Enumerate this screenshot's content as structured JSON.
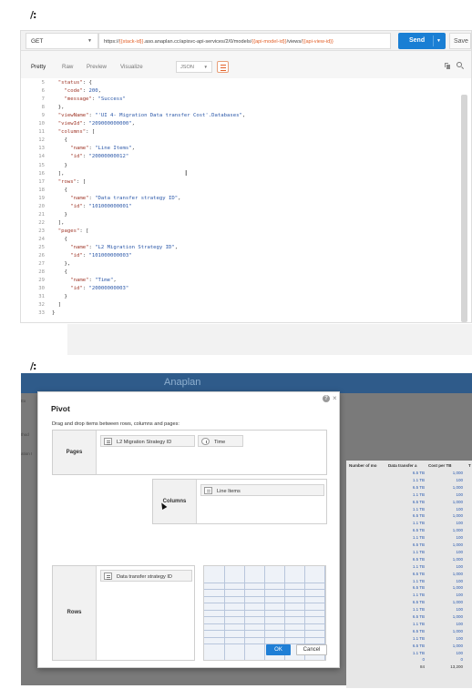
{
  "top": {
    "method": "GET",
    "url_parts": [
      {
        "t": "https://",
        "var": false
      },
      {
        "t": "{{stack-id}}",
        "var": true
      },
      {
        "t": ".aso.anaplan.cc/apisvc-api-services/2/0/models/",
        "var": false
      },
      {
        "t": "{{api-model-id}}",
        "var": true
      },
      {
        "t": "/views/",
        "var": false
      },
      {
        "t": "{{api-view-id}}",
        "var": true
      }
    ],
    "send_label": "Send",
    "save_label": "Save",
    "response_tabs": [
      "Pretty",
      "Raw",
      "Preview",
      "Visualize"
    ],
    "format": "JSON",
    "code_lines": [
      {
        "n": "5",
        "text": "  \"status\": {"
      },
      {
        "n": "6",
        "text": "    \"code\": 200,"
      },
      {
        "n": "7",
        "text": "    \"message\": \"Success\""
      },
      {
        "n": "8",
        "text": "  },"
      },
      {
        "n": "9",
        "text": "  \"viewName\": \"'UI 4- Migration Data transfer Cost'.Databases\","
      },
      {
        "n": "10",
        "text": "  \"viewId\": \"209000000000\","
      },
      {
        "n": "11",
        "text": "  \"columns\": ["
      },
      {
        "n": "12",
        "text": "    {"
      },
      {
        "n": "13",
        "text": "      \"name\": \"Line Items\","
      },
      {
        "n": "14",
        "text": "      \"id\": \"20000000012\""
      },
      {
        "n": "15",
        "text": "    }"
      },
      {
        "n": "16",
        "text": "  ],"
      },
      {
        "n": "17",
        "text": "  \"rows\": ["
      },
      {
        "n": "18",
        "text": "    {"
      },
      {
        "n": "19",
        "text": "      \"name\": \"Data transfer strategy ID\","
      },
      {
        "n": "20",
        "text": "      \"id\": \"101000000001\""
      },
      {
        "n": "21",
        "text": "    }"
      },
      {
        "n": "22",
        "text": "  ],"
      },
      {
        "n": "23",
        "text": "  \"pages\": ["
      },
      {
        "n": "24",
        "text": "    {"
      },
      {
        "n": "25",
        "text": "      \"name\": \"L2 Migration Strategy ID\","
      },
      {
        "n": "26",
        "text": "      \"id\": \"101000000003\""
      },
      {
        "n": "27",
        "text": "    },"
      },
      {
        "n": "28",
        "text": "    {"
      },
      {
        "n": "29",
        "text": "      \"name\": \"Time\","
      },
      {
        "n": "30",
        "text": "      \"id\": \"20000000003\""
      },
      {
        "n": "31",
        "text": "    }"
      },
      {
        "n": "32",
        "text": "  ]"
      },
      {
        "n": "33",
        "text": "}"
      }
    ]
  },
  "bottom": {
    "brand": "Anaplan",
    "background_labels": [
      "Ex",
      "thod",
      "ation I"
    ],
    "background_columns": [
      "Number of mo",
      "Data transfer a",
      "Cost per TB",
      "T"
    ],
    "background_rows": [
      [
        "6.5 TB",
        "1,000"
      ],
      [
        "1.1 TB",
        "100"
      ],
      [
        "6.5 TB",
        "1,000"
      ],
      [
        "1.1 TB",
        "100"
      ],
      [
        "6.5 TB",
        "1,000"
      ],
      [
        "1.1 TB",
        "100"
      ],
      [
        "6.5 TB",
        "1,000"
      ],
      [
        "1.1 TB",
        "100"
      ],
      [
        "6.5 TB",
        "1,000"
      ],
      [
        "1.1 TB",
        "100"
      ],
      [
        "6.5 TB",
        "1,000"
      ],
      [
        "1.1 TB",
        "100"
      ],
      [
        "6.5 TB",
        "1,000"
      ],
      [
        "1.1 TB",
        "100"
      ],
      [
        "6.5 TB",
        "1,000"
      ],
      [
        "1.1 TB",
        "100"
      ],
      [
        "6.5 TB",
        "1,000"
      ],
      [
        "1.1 TB",
        "100"
      ],
      [
        "6.5 TB",
        "1,000"
      ],
      [
        "1.1 TB",
        "100"
      ],
      [
        "6.5 TB",
        "1,000"
      ],
      [
        "1.1 TB",
        "100"
      ],
      [
        "6.5 TB",
        "1,000"
      ],
      [
        "1.1 TB",
        "100"
      ],
      [
        "6.5 TB",
        "1,000"
      ],
      [
        "1.1 TB",
        "100"
      ],
      [
        "0",
        "0"
      ]
    ],
    "background_total": [
      "84",
      "13,200"
    ],
    "pivot": {
      "title": "Pivot",
      "instructions": "Drag and drop items between rows, columns and pages:",
      "pages_label": "Pages",
      "columns_label": "Columns",
      "rows_label": "Rows",
      "pages_items": [
        "L2 Migration Strategy ID",
        "Time"
      ],
      "columns_items": [
        "Line Items"
      ],
      "rows_items": [
        "Data transfer strategy ID"
      ],
      "ok_label": "OK",
      "cancel_label": "Cancel"
    }
  },
  "colors": {
    "send": "#1a7fd4",
    "anaplan_header": "#2f5b8a",
    "ok_button": "#1f7fd6",
    "url_variable": "#e2612a"
  }
}
